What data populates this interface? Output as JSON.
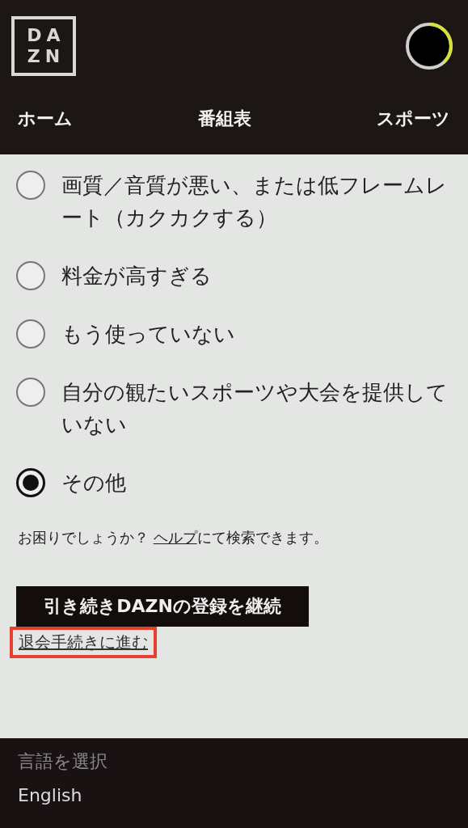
{
  "header": {
    "logo_lines": [
      "DA",
      "ZN"
    ],
    "nav": [
      {
        "label": "ホーム"
      },
      {
        "label": "番組表"
      },
      {
        "label": "スポーツ"
      }
    ]
  },
  "options": [
    {
      "label": "画質／音質が悪い、または低フレームレート（カクカクする）",
      "selected": false
    },
    {
      "label": "料金が高すぎる",
      "selected": false
    },
    {
      "label": "もう使っていない",
      "selected": false
    },
    {
      "label": "自分の観たいスポーツや大会を提供していない",
      "selected": false
    },
    {
      "label": "その他",
      "selected": true
    }
  ],
  "help": {
    "before": "お困りでしょうか？ ",
    "link": "ヘルプ",
    "after": "にて検索できます。"
  },
  "continue_button": "引き続き**DAZN**の登録を継続",
  "cancel_link": {
    "label": "退会手続きに進む",
    "highlighted": true
  },
  "footer": {
    "heading": "言語を選択",
    "language": "English"
  }
}
